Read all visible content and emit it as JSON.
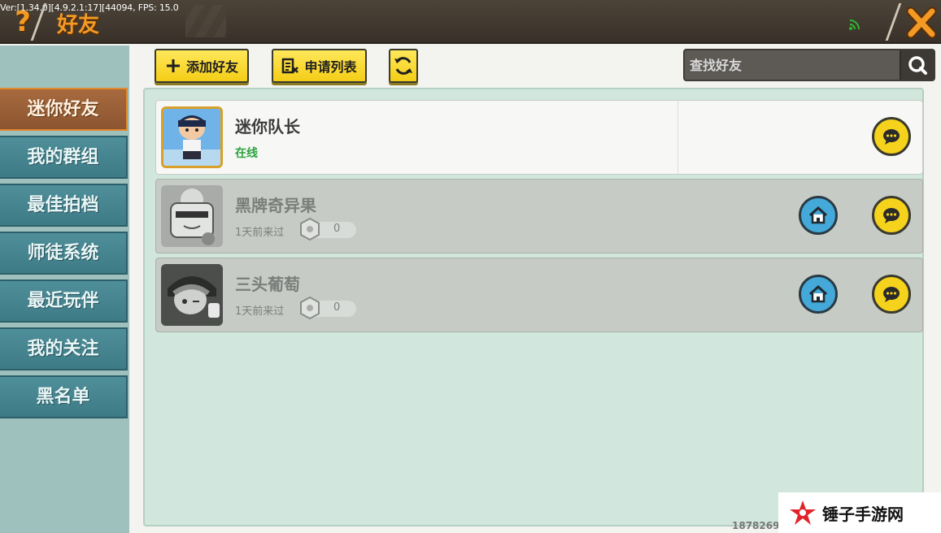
{
  "header": {
    "debug_text": "Ver:[1.34.0][4.9.2.1:17][44094,  FPS: 15.0",
    "help_label": "?",
    "title": "好友"
  },
  "sidebar": {
    "items": [
      {
        "label": "迷你好友",
        "active": true
      },
      {
        "label": "我的群组",
        "active": false
      },
      {
        "label": "最佳拍档",
        "active": false
      },
      {
        "label": "师徒系统",
        "active": false
      },
      {
        "label": "最近玩伴",
        "active": false
      },
      {
        "label": "我的关注",
        "active": false
      },
      {
        "label": "黑名单",
        "active": false
      }
    ]
  },
  "toolbar": {
    "add_friend_label": "添加好友",
    "request_list_label": "申请列表",
    "search_placeholder": "查找好友"
  },
  "friends": [
    {
      "name": "迷你队长",
      "status": "在线"
    },
    {
      "name": "黑牌奇异果",
      "last_seen": "1天前来过",
      "score": "0"
    },
    {
      "name": "三头葡萄",
      "last_seen": "1天前来过",
      "score": "0"
    }
  ],
  "footer": {
    "id_text": "1878269",
    "watermark": "锤子手游网"
  },
  "colors": {
    "accent_orange": "#f39a25",
    "button_yellow": "#f4cd16",
    "sidebar_teal": "#3d7b86",
    "online_green": "#2aa33e",
    "home_blue": "#44a8d8"
  },
  "icons": {
    "help": "question-mark-icon",
    "signal": "signal-icon",
    "close": "close-icon",
    "add": "plus-icon",
    "list": "list-icon",
    "refresh": "refresh-icon",
    "search": "search-icon",
    "chat": "chat-bubble-icon",
    "home": "home-icon",
    "score": "hexagon-icon"
  }
}
